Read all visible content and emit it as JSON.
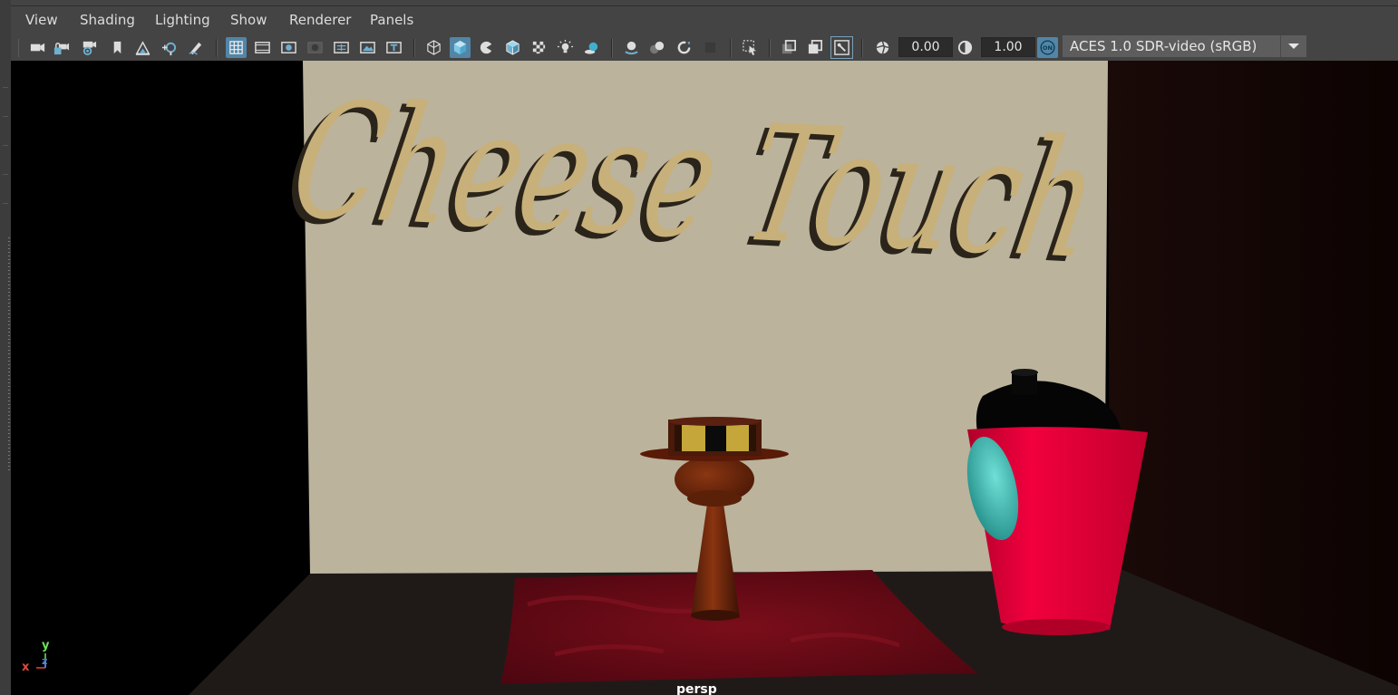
{
  "menu": {
    "items": [
      "View",
      "Shading",
      "Lighting",
      "Show",
      "Renderer",
      "Panels"
    ]
  },
  "toolbar": {
    "icons": [
      "camera-icon",
      "lock-camera-icon",
      "camera-attributes-icon",
      "bookmark-icon",
      "image-plane-icon",
      "2d-pan-zoom-icon",
      "grease-pencil-icon",
      "grid-icon",
      "film-gate-icon",
      "resolution-gate-icon",
      "gate-mask-icon",
      "field-chart-icon",
      "safe-action-icon",
      "safe-title-icon",
      "wireframe-icon",
      "smooth-shade-icon",
      "default-material-icon",
      "wireframe-on-shaded-icon",
      "textured-icon",
      "use-all-lights-icon",
      "shadows-icon",
      "screen-space-ao-icon",
      "motion-blur-icon",
      "anti-aliasing-icon",
      "depth-of-field-icon",
      "isolate-select-icon",
      "xray-icon",
      "xray-active-components-icon",
      "xray-joints-icon",
      "exposure-icon",
      "gamma-icon",
      "color-management-icon",
      "dropdown-arrow-icon"
    ],
    "exposure_value": "0.00",
    "gamma_value": "1.00",
    "color_management_badge": "ON",
    "view_transform": "ACES 1.0 SDR-video (sRGB)"
  },
  "viewport": {
    "scene_text": "Cheese Touch",
    "camera_label": "persp",
    "axis_x": "x",
    "axis_y": "y",
    "axis_z": "z"
  },
  "colors": {
    "accent": "#5285a6",
    "ui_background": "#444444",
    "viewport_background": "#000000",
    "axis_x": "#e0483e",
    "axis_y": "#6ee35a",
    "axis_z": "#4c7ce6"
  }
}
